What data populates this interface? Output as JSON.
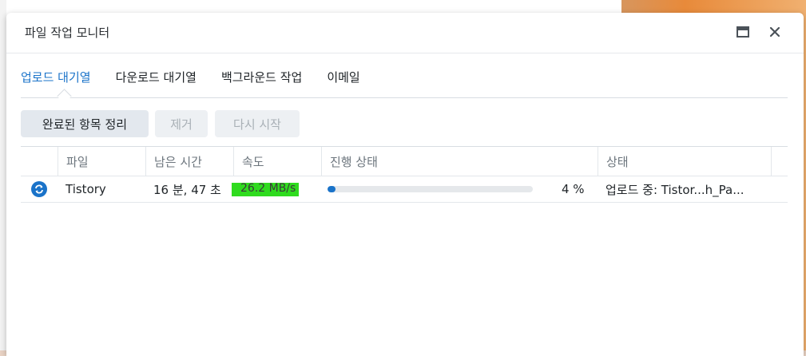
{
  "window": {
    "title": "파일 작업 모니터",
    "maximize_icon": "maximize-icon",
    "close_icon": "close-icon"
  },
  "tabs": [
    {
      "label": "업로드 대기열",
      "active": true
    },
    {
      "label": "다운로드 대기열",
      "active": false
    },
    {
      "label": "백그라운드 작업",
      "active": false
    },
    {
      "label": "이메일",
      "active": false
    }
  ],
  "toolbar": {
    "clear_completed": "완료된 항목 정리",
    "remove": "제거",
    "restart": "다시 시작"
  },
  "table": {
    "columns": [
      "파일",
      "남은 시간",
      "속도",
      "진행 상태",
      "상태"
    ],
    "rows": [
      {
        "icon": "sync-icon",
        "file": "Tistory",
        "remaining": "16 분, 47 초",
        "speed": "26.2 MB/s",
        "progress": 4,
        "progress_label": "4 %",
        "status": "업로드 중: Tistor...h_Pa..."
      }
    ]
  },
  "colors": {
    "accent": "#1a73c9",
    "speed_highlight": "#2fdb1e"
  }
}
